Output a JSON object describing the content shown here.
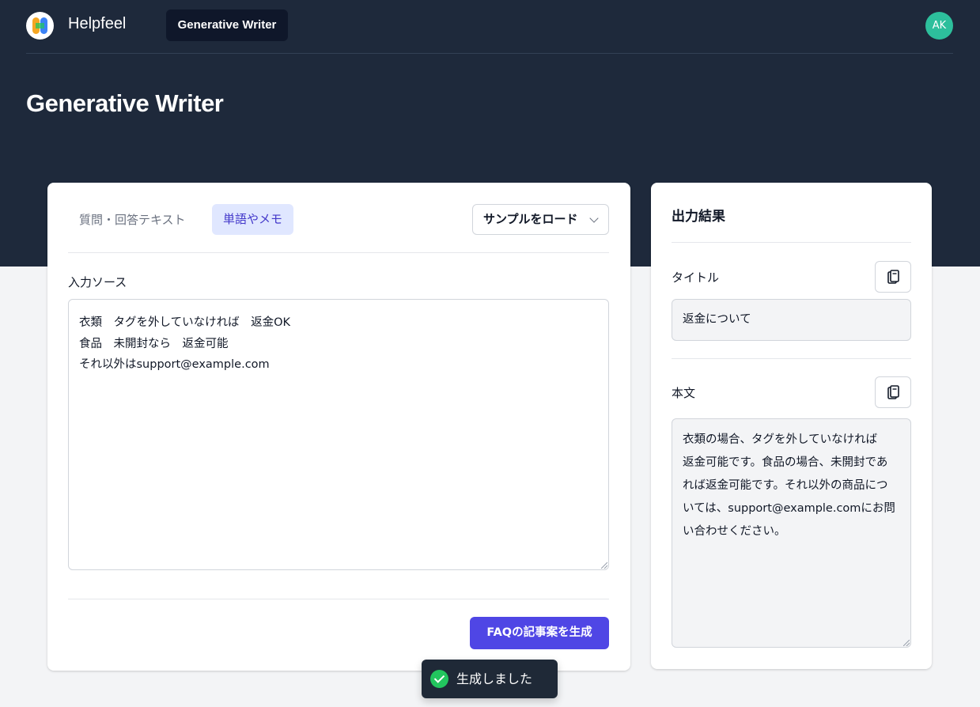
{
  "header": {
    "brand": "Helpfeel",
    "nav_tab": "Generative Writer",
    "avatar_initials": "AK",
    "page_title": "Generative Writer"
  },
  "input_panel": {
    "tabs": [
      {
        "label": "質問・回答テキスト",
        "active": false
      },
      {
        "label": "単語やメモ",
        "active": true
      }
    ],
    "sample_select_value": "サンプルをロード",
    "source_label": "入力ソース",
    "source_text": "衣類　タグを外していなければ　返金OK\n食品　未開封なら　返金可能\nそれ以外はsupport@example.com",
    "generate_button": "FAQの記事案を生成"
  },
  "output_panel": {
    "heading": "出力結果",
    "title_label": "タイトル",
    "title_value": "返金について",
    "body_label": "本文",
    "body_value": "衣類の場合、タグを外していなければ\n返金可能です。食品の場合、未開封であ\nれば返金可能です。それ以外の商品につ\nいては、support@example.comにお問\nい合わせください。"
  },
  "toast": {
    "message": "生成しました"
  },
  "colors": {
    "header_bg": "#1e293b",
    "accent": "#4f46e5",
    "avatar": "#2dbf9c",
    "success": "#22c55e"
  }
}
